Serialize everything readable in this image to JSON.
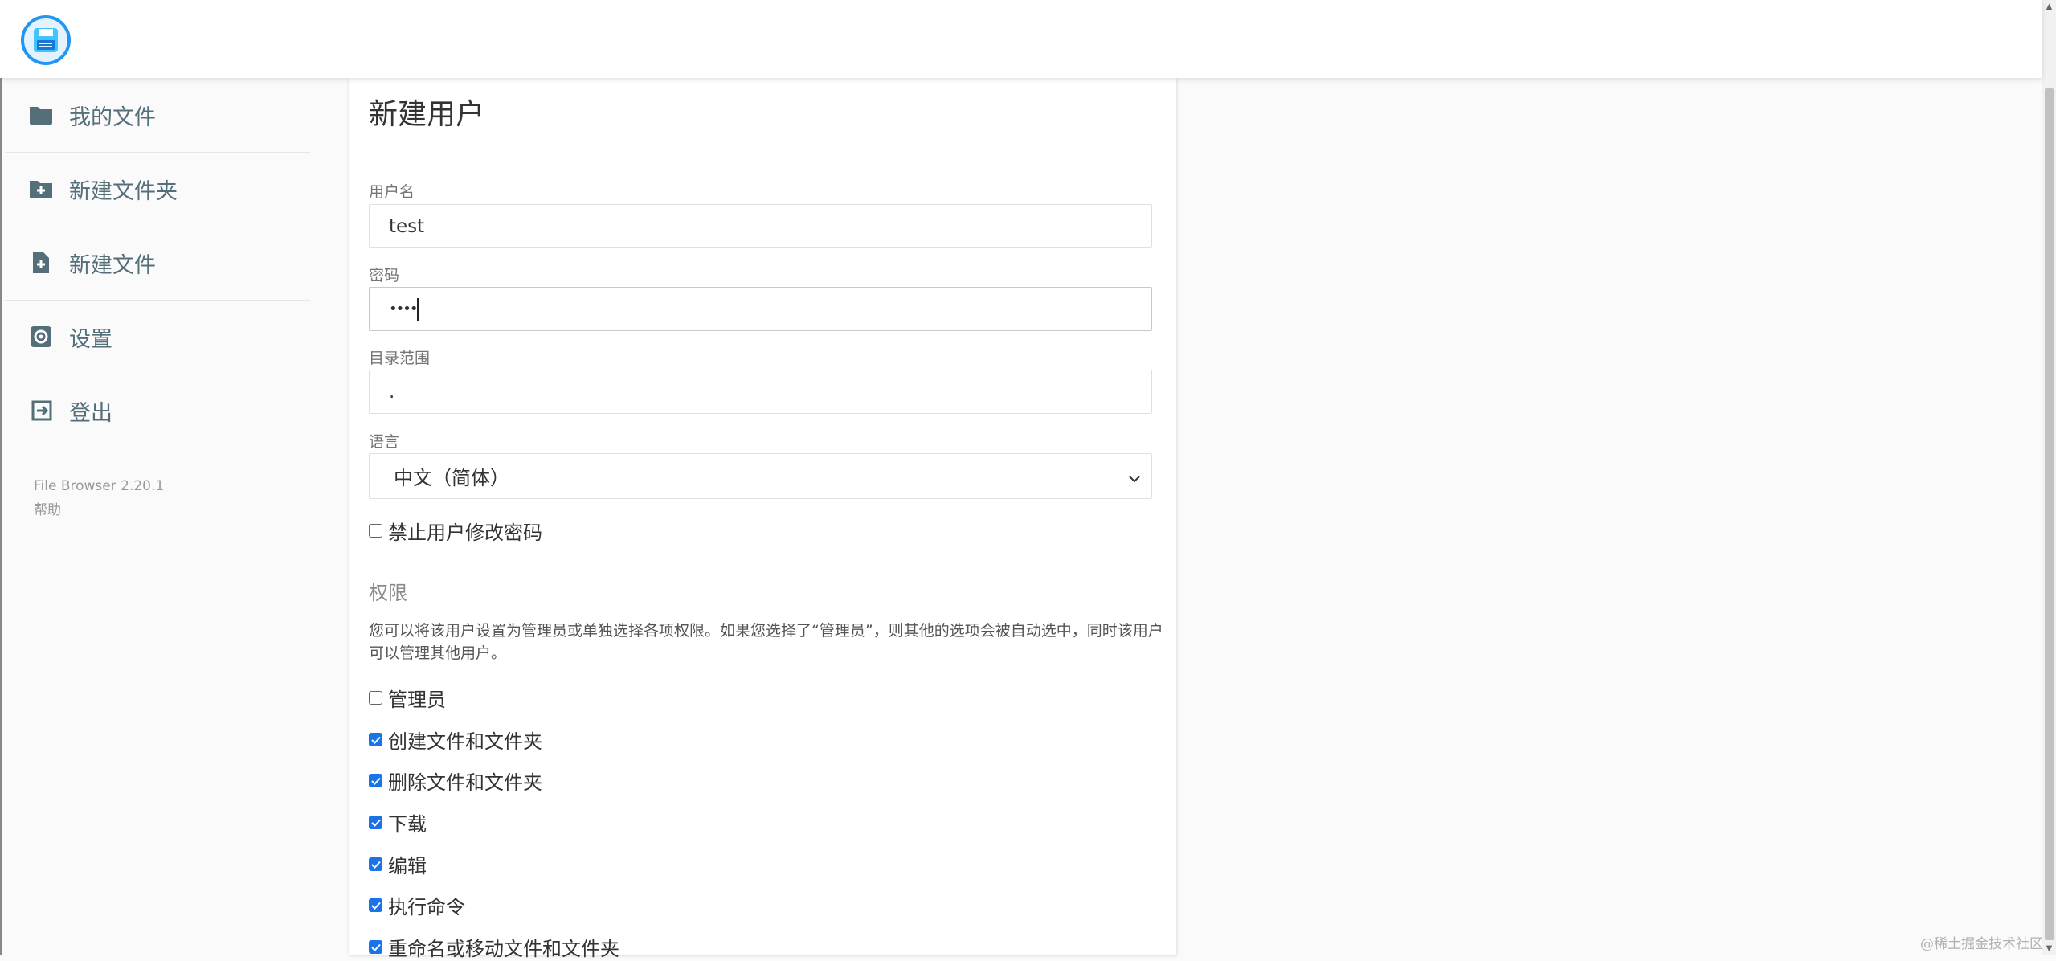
{
  "app": {
    "version": "File Browser 2.20.1",
    "help": "帮助"
  },
  "sidebar": {
    "items": [
      {
        "label": "我的文件",
        "icon": "folder-icon"
      },
      {
        "label": "新建文件夹",
        "icon": "folder-plus-icon"
      },
      {
        "label": "新建文件",
        "icon": "file-plus-icon"
      },
      {
        "label": "设置",
        "icon": "settings-icon"
      },
      {
        "label": "登出",
        "icon": "logout-icon"
      }
    ]
  },
  "form": {
    "title": "新建用户",
    "username": {
      "label": "用户名",
      "value": "test"
    },
    "password": {
      "label": "密码",
      "value": "••••"
    },
    "scope": {
      "label": "目录范围",
      "value": "."
    },
    "language": {
      "label": "语言",
      "value": "中文（简体）"
    },
    "lock_password": {
      "label": "禁止用户修改密码",
      "checked": false
    }
  },
  "permissions": {
    "title": "权限",
    "description": "您可以将该用户设置为管理员或单独选择各项权限。如果您选择了“管理员”，则其他的选项会被自动选中，同时该用户可以管理其他用户。",
    "items": [
      {
        "label": "管理员",
        "checked": false
      },
      {
        "label": "创建文件和文件夹",
        "checked": true
      },
      {
        "label": "删除文件和文件夹",
        "checked": true
      },
      {
        "label": "下载",
        "checked": true
      },
      {
        "label": "编辑",
        "checked": true
      },
      {
        "label": "执行命令",
        "checked": true
      },
      {
        "label": "重命名或移动文件和文件夹",
        "checked": true
      }
    ]
  },
  "watermark": "@稀土掘金技术社区",
  "colors": {
    "accent": "#2196f3",
    "icon": "#546e7a",
    "checkbox": "#1a73e8"
  }
}
